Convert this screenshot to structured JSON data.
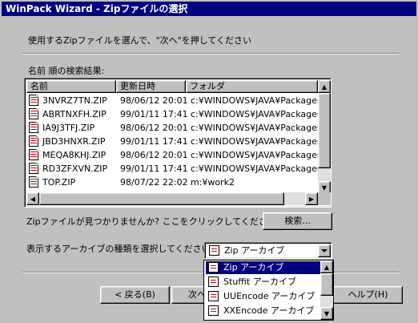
{
  "window": {
    "title": "WinPack Wizard - Zipファイルの選択"
  },
  "instruction": "使用するZipファイルを選んで、\"次へ\"を押してください",
  "results_label": "名前 順の検索結果:",
  "table": {
    "columns": [
      "名前",
      "更新日時",
      "フォルダ"
    ],
    "rows": [
      {
        "name": "3NVRZ7TN.ZIP",
        "date": "98/06/12 20:01",
        "folder": "c:¥WINDOWS¥JAVA¥Packages"
      },
      {
        "name": "ABRTNXFH.ZIP",
        "date": "99/01/11 17:41",
        "folder": "c:¥WINDOWS¥JAVA¥Packages"
      },
      {
        "name": "IA9J3TFJ.ZIP",
        "date": "98/06/12 20:01",
        "folder": "c:¥WINDOWS¥JAVA¥Packages"
      },
      {
        "name": "JBD3HNXR.ZIP",
        "date": "99/01/11 17:41",
        "folder": "c:¥WINDOWS¥JAVA¥Packages"
      },
      {
        "name": "MEQA8KHJ.ZIP",
        "date": "98/06/12 20:01",
        "folder": "c:¥WINDOWS¥JAVA¥Packages"
      },
      {
        "name": "RD3ZFXVN.ZIP",
        "date": "99/01/11 17:41",
        "folder": "c:¥WINDOWS¥JAVA¥Packages"
      },
      {
        "name": "TOP.ZIP",
        "date": "98/07/22 22:02",
        "folder": "m:¥work2"
      }
    ]
  },
  "not_found_text": "Zipファイルが見つかりませんか? ここをクリックしてください:",
  "search_button": "検索...",
  "archive_type_label": "表示するアーカイブの種類を選択してください:",
  "archive_type": {
    "selected": "Zip アーカイブ",
    "options": [
      "Zip アーカイブ",
      "Stuffit アーカイブ",
      "UUEncode アーカイブ",
      "XXEncode アーカイブ"
    ]
  },
  "buttons": {
    "back": "< 戻る(B)",
    "next": "次へ",
    "help": "ヘルプ(H)"
  },
  "colors": {
    "titlebar": "#000080",
    "face": "#c0c0c0",
    "selection": "#000080"
  }
}
